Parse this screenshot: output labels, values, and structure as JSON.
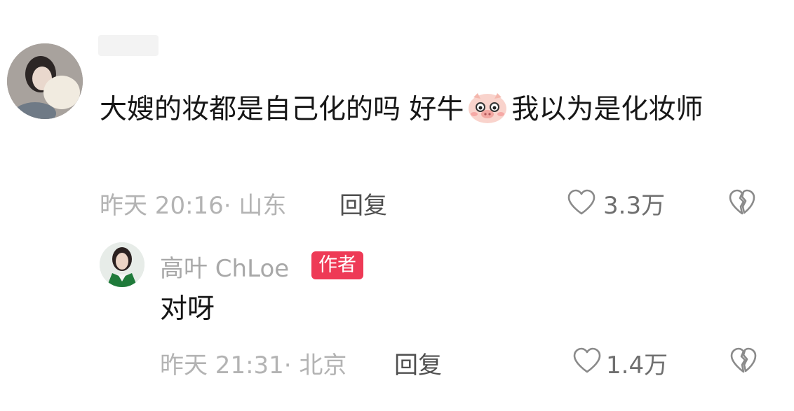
{
  "comment": {
    "text_part1": "大嫂的妆都是自己化的吗 好牛",
    "emoji": "pig-face-emoji",
    "text_part2": "我以为是化妆师",
    "time_location": "昨天 20:16· 山东",
    "reply_label": "回复",
    "like_count": "3.3万"
  },
  "reply": {
    "author_name": "高叶 ChLoe",
    "author_badge": "作者",
    "text": "对呀",
    "time_location": "昨天 21:31· 北京",
    "reply_label": "回复",
    "like_count": "1.4万"
  },
  "colors": {
    "badge": "#ee3a56",
    "meta_text": "#b3b3b3",
    "reply_link": "#4f4f4f"
  },
  "icons": [
    "heart-outline-icon",
    "broken-heart-icon",
    "pig-face-emoji"
  ]
}
